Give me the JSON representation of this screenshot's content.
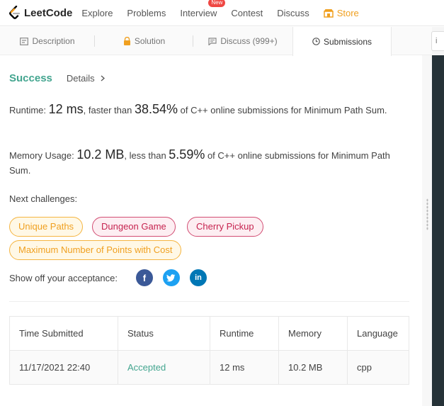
{
  "nav": {
    "logo_text": "LeetCode",
    "items": [
      "Explore",
      "Problems",
      "Interview",
      "Contest",
      "Discuss"
    ],
    "interview_badge": "New",
    "store": "Store",
    "colors": {
      "store": "#f0a020",
      "badge": "#ef4743"
    }
  },
  "tabs": [
    {
      "label": "Description",
      "icon": "document-icon"
    },
    {
      "label": "Solution",
      "icon": "lock-icon"
    },
    {
      "label": "Discuss (999+)",
      "icon": "comment-icon"
    },
    {
      "label": "Submissions",
      "icon": "clock-icon"
    }
  ],
  "right_input": {
    "placeholder": "i"
  },
  "result": {
    "status": "Success",
    "details": "Details",
    "runtime": {
      "label": "Runtime: ",
      "value": "12 ms",
      "mid": ", faster than ",
      "percent": "38.54%",
      "suffix": " of C++ online submissions for Minimum Path Sum."
    },
    "memory": {
      "label": "Memory Usage: ",
      "value": "10.2 MB",
      "mid": ", less than ",
      "percent": "5.59%",
      "suffix": " of C++ online submissions for Minimum Path Sum."
    },
    "next_label": "Next challenges:",
    "challenges": [
      {
        "label": "Unique Paths",
        "difficulty": "medium"
      },
      {
        "label": "Dungeon Game",
        "difficulty": "hard"
      },
      {
        "label": "Cherry Pickup",
        "difficulty": "hard"
      },
      {
        "label": "Maximum Number of Points with Cost",
        "difficulty": "medium"
      }
    ],
    "share_label": "Show off your acceptance:",
    "share": [
      {
        "name": "facebook-icon",
        "glyph": "f",
        "color": "#3b5998"
      },
      {
        "name": "twitter-icon",
        "glyph": "t",
        "color": "#1da1f2"
      },
      {
        "name": "linkedin-icon",
        "glyph": "in",
        "color": "#0077b5"
      }
    ]
  },
  "table": {
    "headers": [
      "Time Submitted",
      "Status",
      "Runtime",
      "Memory",
      "Language"
    ],
    "rows": [
      [
        "11/17/2021 22:40",
        "Accepted",
        "12 ms",
        "10.2 MB",
        "cpp"
      ]
    ],
    "accepted_color": "#43a58f"
  }
}
